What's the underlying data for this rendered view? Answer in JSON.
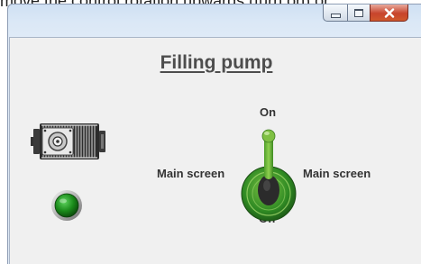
{
  "background_text": "move the control rotation upwards (turn on) or",
  "window": {
    "title": "Filling pump"
  },
  "switch": {
    "on_label": "On",
    "off_label": "Off",
    "left_label": "Main screen",
    "right_label": "Main screen",
    "state": "on"
  },
  "indicator": {
    "color": "#1a8a1a",
    "state": "on"
  },
  "icons": {
    "motor": "motor-icon",
    "indicator": "status-led-icon",
    "switch": "toggle-switch-icon",
    "minimize": "minimize-icon",
    "maximize": "maximize-icon",
    "close": "close-icon"
  }
}
